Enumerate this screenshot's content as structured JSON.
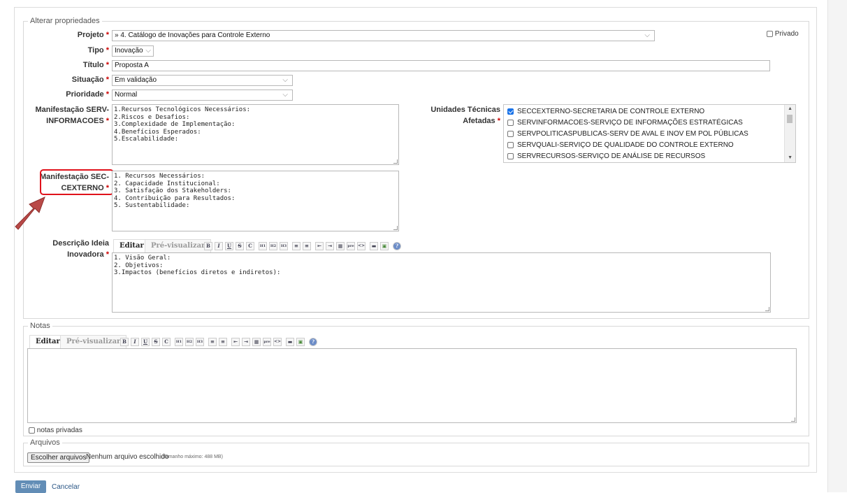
{
  "form": {
    "legend": "Alterar propriedades",
    "projeto": {
      "label": "Projeto",
      "req": "*",
      "value": "» 4. Catálogo de Inovações para Controle Externo"
    },
    "privado_label": "Privado",
    "tipo": {
      "label": "Tipo",
      "req": "*",
      "value": "Inovação"
    },
    "titulo": {
      "label": "Título",
      "req": "*",
      "value": "Proposta A"
    },
    "situacao": {
      "label": "Situação",
      "req": "*",
      "value": "Em validação"
    },
    "prioridade": {
      "label": "Prioridade",
      "req": "*",
      "value": "Normal"
    },
    "manif_serv": {
      "label_line1": "Manifestação SERV-",
      "label_line2": "INFORMACOES",
      "req": "*",
      "value": "1.Recursos Tecnológicos Necessários:\n2.Riscos e Desafios:\n3.Complexidade de Implementação:\n4.Benefícios Esperados:\n5.Escalabilidade:"
    },
    "manif_sec": {
      "label_line1": "Manifestação SEC-",
      "label_line2": "CEXTERNO",
      "req": "*",
      "value": "1. Recursos Necessários:\n2. Capacidade Institucional:\n3. Satisfação dos Stakeholders:\n4. Contribuição para Resultados:\n5. Sustentabilidade:"
    },
    "unidades": {
      "label_line1": "Unidades Técnicas",
      "label_line2": "Afetadas",
      "req": "*",
      "items": [
        {
          "label": "SECCEXTERNO-SECRETARIA DE CONTROLE EXTERNO",
          "checked": true
        },
        {
          "label": "SERVINFORMACOES-SERVIÇO DE INFORMAÇÕES ESTRATÉGICAS",
          "checked": false
        },
        {
          "label": "SERVPOLITICASPUBLICAS-SERV DE AVAL E INOV EM POL PÚBLICAS",
          "checked": false
        },
        {
          "label": "SERVQUALI-SERVIÇO DE QUALIDADE DO CONTROLE EXTERNO",
          "checked": false
        },
        {
          "label": "SERVRECURSOS-SERVIÇO DE ANÁLISE DE RECURSOS",
          "checked": false
        }
      ]
    },
    "descricao": {
      "label_line1": "Descrição Ideia",
      "label_line2": "Inovadora",
      "req": "*",
      "value": "1. Visão Geral:\n2. Objetivos:\n3.Impactos (benefícios diretos e indiretos):"
    }
  },
  "editor": {
    "tab_edit": "Editar",
    "tab_preview": "Pré-visualizar",
    "toolbar": [
      "B",
      "I",
      "U",
      "S",
      "C",
      "H1",
      "H2",
      "H3",
      "≡",
      "≡",
      "⇤",
      "⇥",
      "▦",
      "pre",
      "<>",
      "▬",
      "▣",
      "?"
    ]
  },
  "notas": {
    "legend": "Notas",
    "value": "",
    "private_label": "notas privadas"
  },
  "arquivos": {
    "legend": "Arquivos",
    "button": "Escolher arquivos",
    "status": "Nenhum arquivo escolhido",
    "max": "(Tamanho máximo: 488 MB)"
  },
  "actions": {
    "submit": "Enviar",
    "cancel": "Cancelar"
  },
  "colors": {
    "highlight": "#e0121b",
    "arrow": "#b94a48",
    "primary_button": "#628db6"
  }
}
